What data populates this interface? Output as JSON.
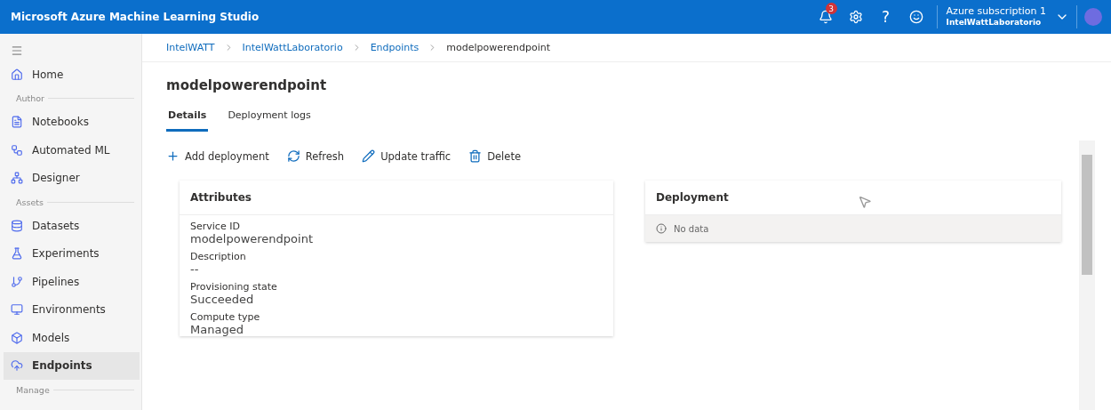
{
  "header": {
    "title": "Microsoft Azure Machine Learning Studio",
    "notifications": "3",
    "help": "?",
    "subscription": "Azure subscription 1",
    "workspace": "IntelWattLaboratorio"
  },
  "sidebar": {
    "items": [
      {
        "kind": "item",
        "label": "Home",
        "selected": false
      },
      {
        "kind": "section",
        "label": "Author"
      },
      {
        "kind": "item",
        "label": "Notebooks",
        "selected": false
      },
      {
        "kind": "item",
        "label": "Automated ML",
        "selected": false
      },
      {
        "kind": "item",
        "label": "Designer",
        "selected": false
      },
      {
        "kind": "section",
        "label": "Assets"
      },
      {
        "kind": "item",
        "label": "Datasets",
        "selected": false
      },
      {
        "kind": "item",
        "label": "Experiments",
        "selected": false
      },
      {
        "kind": "item",
        "label": "Pipelines",
        "selected": false
      },
      {
        "kind": "item",
        "label": "Environments",
        "selected": false
      },
      {
        "kind": "item",
        "label": "Models",
        "selected": false
      },
      {
        "kind": "item",
        "label": "Endpoints",
        "selected": true
      },
      {
        "kind": "section",
        "label": "Manage"
      }
    ]
  },
  "breadcrumb": [
    {
      "label": "IntelWATT",
      "link": true
    },
    {
      "label": "IntelWattLaboratorio",
      "link": true
    },
    {
      "label": "Endpoints",
      "link": true
    },
    {
      "label": "modelpowerendpoint",
      "link": false
    }
  ],
  "page_title": "modelpowerendpoint",
  "tabs": [
    {
      "label": "Details",
      "selected": true
    },
    {
      "label": "Deployment logs",
      "selected": false
    }
  ],
  "toolbar": [
    {
      "label": "Add deployment"
    },
    {
      "label": "Refresh"
    },
    {
      "label": "Update traffic"
    },
    {
      "label": "Delete"
    }
  ],
  "attributes": {
    "title": "Attributes",
    "fields": [
      {
        "label": "Service ID",
        "value": "modelpowerendpoint"
      },
      {
        "label": "Description",
        "value": "--"
      },
      {
        "label": "Provisioning state",
        "value": "Succeeded"
      },
      {
        "label": "Compute type",
        "value": "Managed"
      }
    ]
  },
  "deployment": {
    "title": "Deployment",
    "message": "No data"
  }
}
